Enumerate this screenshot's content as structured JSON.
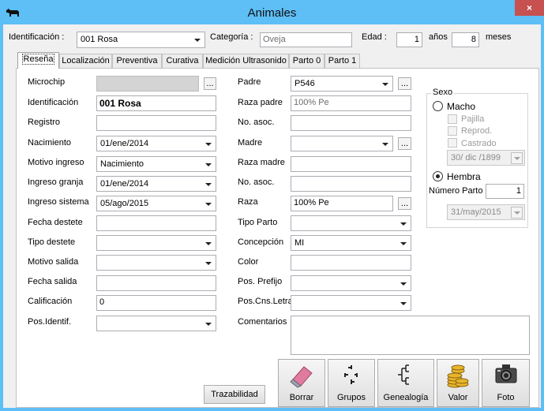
{
  "window": {
    "title": "Animales",
    "close": "×"
  },
  "header": {
    "id_label": "Identificación :",
    "id_value": "001 Rosa",
    "category_label": "Categoría :",
    "category_value": "Oveja",
    "age_label": "Edad :",
    "age_years": "1",
    "years_label": "años",
    "age_months": "8",
    "months_label": "meses"
  },
  "tabs": [
    "Reseña",
    "Localización",
    "Preventiva",
    "Curativa",
    "Medición Ultrasonido",
    "Parto 0",
    "Parto 1"
  ],
  "left_fields": {
    "microchip": {
      "label": "Microchip",
      "value": ""
    },
    "identificacion": {
      "label": "Identificación",
      "value": "001 Rosa"
    },
    "registro": {
      "label": "Registro",
      "value": ""
    },
    "nacimiento": {
      "label": "Nacimiento",
      "value": "01/ene/2014"
    },
    "motivo_ingreso": {
      "label": "Motivo ingreso",
      "value": "Nacimiento"
    },
    "ingreso_granja": {
      "label": "Ingreso granja",
      "value": "01/ene/2014"
    },
    "ingreso_sistema": {
      "label": "Ingreso sistema",
      "value": "05/ago/2015"
    },
    "fecha_destete": {
      "label": "Fecha destete",
      "value": ""
    },
    "tipo_destete": {
      "label": "Tipo destete",
      "value": ""
    },
    "motivo_salida": {
      "label": "Motivo salida",
      "value": ""
    },
    "fecha_salida": {
      "label": "Fecha salida",
      "value": ""
    },
    "calificacion": {
      "label": "Calificación",
      "value": "0"
    },
    "pos_identif": {
      "label": "Pos.Identif.",
      "value": ""
    }
  },
  "right_fields": {
    "padre": {
      "label": "Padre",
      "value": "P546"
    },
    "raza_padre": {
      "label": "Raza padre",
      "value": "100% Pe"
    },
    "no_asoc_1": {
      "label": "No. asoc.",
      "value": ""
    },
    "madre": {
      "label": "Madre",
      "value": ""
    },
    "raza_madre": {
      "label": "Raza madre",
      "value": ""
    },
    "no_asoc_2": {
      "label": "No. asoc.",
      "value": ""
    },
    "raza": {
      "label": "Raza",
      "value": "100% Pe"
    },
    "tipo_parto": {
      "label": "Tipo Parto",
      "value": ""
    },
    "concepcion": {
      "label": "Concepción",
      "value": "MI"
    },
    "color": {
      "label": "Color",
      "value": ""
    },
    "pos_prefijo": {
      "label": "Pos. Prefijo",
      "value": ""
    },
    "pos_cns_letra": {
      "label": "Pos.Cns.Letra",
      "value": ""
    },
    "comentarios": {
      "label": "Comentarios",
      "value": ""
    }
  },
  "sexo": {
    "title": "Sexo",
    "macho": "Macho",
    "pajilla": "Pajilla",
    "reprod": "Reprod.",
    "castrado": "Castrado",
    "castrado_date": "30/ dic /1899",
    "hembra": "Hembra",
    "numero_parto_label": "Número Parto",
    "numero_parto_value": "1",
    "parto_date": "31/may/2015",
    "selected": "Hembra"
  },
  "buttons": {
    "ellipsis": "...",
    "trazabilidad": "Trazabilidad",
    "borrar": "Borrar",
    "grupos": "Grupos",
    "genealogia": "Genealogía",
    "valor": "Valor",
    "foto": "Foto"
  },
  "colors": {
    "titlebar": "#5ebef6",
    "close": "#c75050"
  }
}
